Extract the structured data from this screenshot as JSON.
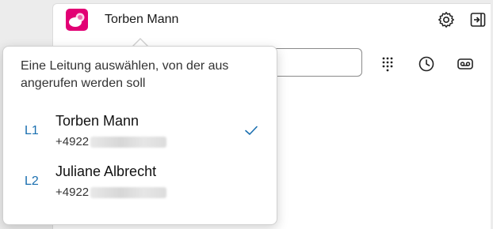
{
  "app": {
    "user_name": "Torben Mann",
    "brand_color": "#e20074"
  },
  "titlebar": {
    "settings_icon": "gear-icon",
    "signout_icon": "sign-out-icon"
  },
  "dialer": {
    "input_value": "",
    "toolbar_icons": [
      "dialpad-icon",
      "history-clock-icon",
      "voicemail-icon"
    ]
  },
  "line_picker": {
    "heading": "Eine Leitung auswählen, von der aus angerufen werden soll",
    "accent_color": "#1a6fb0",
    "lines": [
      {
        "code": "L1",
        "name": "Torben Mann",
        "number_prefix": "+4922",
        "selected": true
      },
      {
        "code": "L2",
        "name": "Juliane Albrecht",
        "number_prefix": "+4922",
        "selected": false
      }
    ]
  }
}
